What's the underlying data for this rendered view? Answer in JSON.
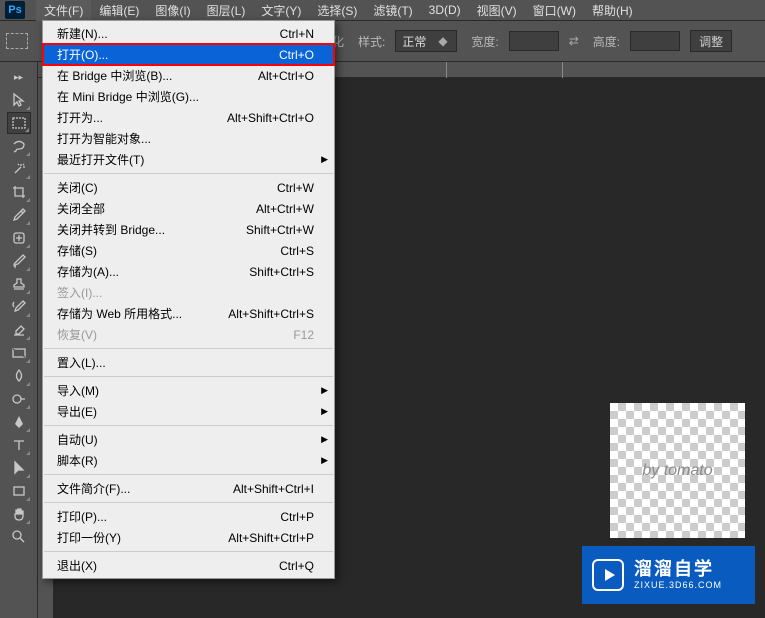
{
  "menubar": {
    "items": [
      "文件(F)",
      "编辑(E)",
      "图像(I)",
      "图层(L)",
      "文字(Y)",
      "选择(S)",
      "滤镜(T)",
      "3D(D)",
      "视图(V)",
      "窗口(W)",
      "帮助(H)"
    ],
    "active_index": 0
  },
  "toolbar": {
    "feather_label": "化",
    "style_label": "样式:",
    "style_value": "正常",
    "width_label": "宽度:",
    "height_label": "高度:",
    "adjust_btn": "调整"
  },
  "file_menu": [
    {
      "label": "新建(N)...",
      "shortcut": "Ctrl+N"
    },
    {
      "label": "打开(O)...",
      "shortcut": "Ctrl+O",
      "highlighted": true
    },
    {
      "label": "在 Bridge 中浏览(B)...",
      "shortcut": "Alt+Ctrl+O"
    },
    {
      "label": "在 Mini Bridge 中浏览(G)..."
    },
    {
      "label": "打开为...",
      "shortcut": "Alt+Shift+Ctrl+O"
    },
    {
      "label": "打开为智能对象..."
    },
    {
      "label": "最近打开文件(T)",
      "submenu": true
    },
    {
      "sep": true
    },
    {
      "label": "关闭(C)",
      "shortcut": "Ctrl+W"
    },
    {
      "label": "关闭全部",
      "shortcut": "Alt+Ctrl+W"
    },
    {
      "label": "关闭并转到 Bridge...",
      "shortcut": "Shift+Ctrl+W"
    },
    {
      "label": "存储(S)",
      "shortcut": "Ctrl+S"
    },
    {
      "label": "存储为(A)...",
      "shortcut": "Shift+Ctrl+S"
    },
    {
      "label": "签入(I)...",
      "disabled": true
    },
    {
      "label": "存储为 Web 所用格式...",
      "shortcut": "Alt+Shift+Ctrl+S"
    },
    {
      "label": "恢复(V)",
      "shortcut": "F12",
      "disabled": true
    },
    {
      "sep": true
    },
    {
      "label": "置入(L)..."
    },
    {
      "sep": true
    },
    {
      "label": "导入(M)",
      "submenu": true
    },
    {
      "label": "导出(E)",
      "submenu": true
    },
    {
      "sep": true
    },
    {
      "label": "自动(U)",
      "submenu": true
    },
    {
      "label": "脚本(R)",
      "submenu": true
    },
    {
      "sep": true
    },
    {
      "label": "文件简介(F)...",
      "shortcut": "Alt+Shift+Ctrl+I"
    },
    {
      "sep": true
    },
    {
      "label": "打印(P)...",
      "shortcut": "Ctrl+P"
    },
    {
      "label": "打印一份(Y)",
      "shortcut": "Alt+Shift+Ctrl+P"
    },
    {
      "sep": true
    },
    {
      "label": "退出(X)",
      "shortcut": "Ctrl+Q"
    }
  ],
  "watermark": "by tomato",
  "brand": {
    "main": "溜溜自学",
    "sub": "ZIXUE.3D66.COM"
  }
}
